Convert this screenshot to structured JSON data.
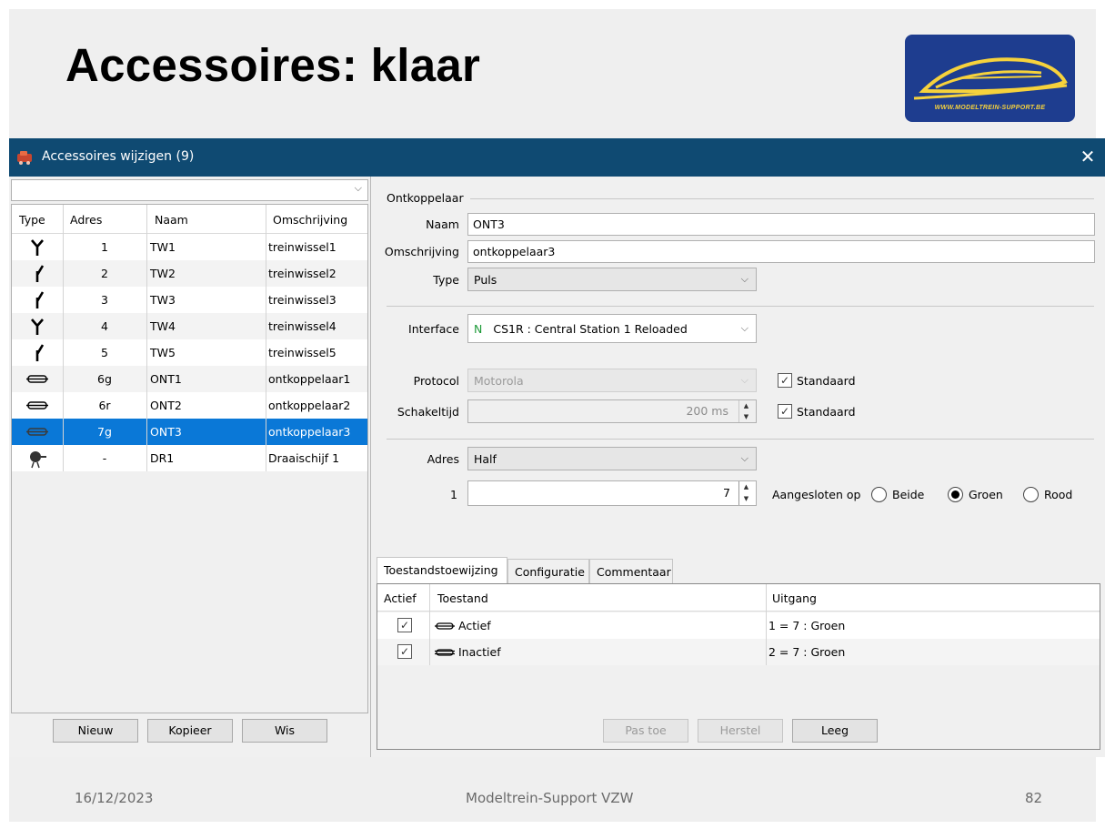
{
  "slide": {
    "title": "Accessoires: klaar",
    "logo_text": "WWW.MODELTREIN-SUPPORT.BE",
    "footer_date": "16/12/2023",
    "footer_center": "Modeltrein-Support VZW",
    "footer_page": "82"
  },
  "window": {
    "title": "Accessoires wijzigen (9)",
    "close_glyph": "✕"
  },
  "accessory_list": {
    "filter_value": "",
    "columns": [
      "Type",
      "Adres",
      "Naam",
      "Omschrijving"
    ],
    "rows": [
      {
        "icon": "turnout-left-icon",
        "adres": "1",
        "naam": "TW1",
        "omschrijving": "treinwissel1"
      },
      {
        "icon": "turnout-right-icon",
        "adres": "2",
        "naam": "TW2",
        "omschrijving": "treinwissel2"
      },
      {
        "icon": "turnout-right-icon",
        "adres": "3",
        "naam": "TW3",
        "omschrijving": "treinwissel3"
      },
      {
        "icon": "turnout-left-icon",
        "adres": "4",
        "naam": "TW4",
        "omschrijving": "treinwissel4"
      },
      {
        "icon": "turnout-right-icon",
        "adres": "5",
        "naam": "TW5",
        "omschrijving": "treinwissel5"
      },
      {
        "icon": "uncoupler-icon",
        "adres": "6g",
        "naam": "ONT1",
        "omschrijving": "ontkoppelaar1"
      },
      {
        "icon": "uncoupler-icon",
        "adres": "6r",
        "naam": "ONT2",
        "omschrijving": "ontkoppelaar2"
      },
      {
        "icon": "uncoupler-icon",
        "adres": "7g",
        "naam": "ONT3",
        "omschrijving": "ontkoppelaar3",
        "selected": true
      },
      {
        "icon": "turntable-icon",
        "adres": "-",
        "naam": "DR1",
        "omschrijving": "Draaischijf 1"
      }
    ],
    "buttons": {
      "new": "Nieuw",
      "copy": "Kopieer",
      "delete": "Wis"
    }
  },
  "detail": {
    "section_title": "Ontkoppelaar",
    "naam_label": "Naam",
    "naam_value": "ONT3",
    "omschrijving_label": "Omschrijving",
    "omschrijving_value": "ontkoppelaar3",
    "type_label": "Type",
    "type_value": "Puls",
    "interface_label": "Interface",
    "interface_prefix": "N",
    "interface_value": "CS1R : Central Station 1 Reloaded",
    "protocol_label": "Protocol",
    "protocol_value": "Motorola",
    "protocol_standaard_label": "Standaard",
    "protocol_standaard_checked": true,
    "schakeltijd_label": "Schakeltijd",
    "schakeltijd_value": "200 ms",
    "schakeltijd_standaard_label": "Standaard",
    "schakeltijd_standaard_checked": true,
    "adres_label": "Adres",
    "adres_value": "Half",
    "port_label": "1",
    "port_value": "7",
    "aangesloten_label": "Aangesloten op",
    "radio_options": [
      "Beide",
      "Groen",
      "Rood"
    ],
    "radio_selected": "Groen"
  },
  "tabs": [
    "Toestandstoewijzing",
    "Configuratie",
    "Commentaar"
  ],
  "active_tab": "Toestandstoewijzing",
  "state_table": {
    "columns": [
      "Actief",
      "Toestand",
      "Uitgang"
    ],
    "rows": [
      {
        "actief": true,
        "toestand": "Actief",
        "uitgang": "1 = 7 : Groen"
      },
      {
        "actief": true,
        "toestand": "Inactief",
        "uitgang": "2 = 7 : Groen"
      }
    ]
  },
  "action_buttons": {
    "apply": "Pas toe",
    "restore": "Herstel",
    "clear": "Leeg"
  },
  "colors": {
    "titlebar": "#0f4a72",
    "selection": "#0a78d7",
    "logo_bg": "#1e3d8f",
    "logo_accent": "#f6d23c"
  }
}
